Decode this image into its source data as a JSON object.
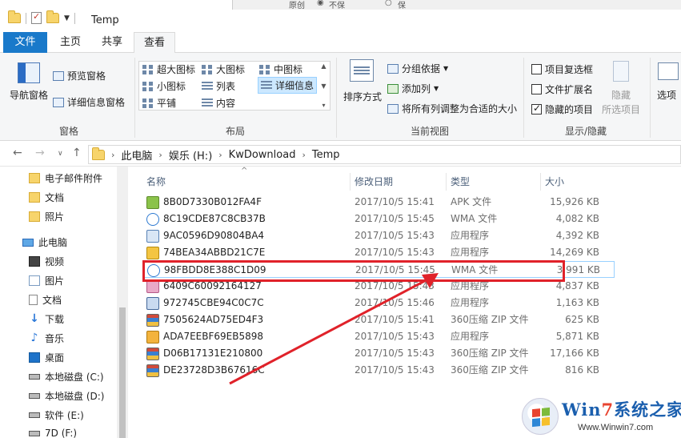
{
  "window": {
    "title": "Temp"
  },
  "top_strip": {
    "label_a": "原创",
    "option_a": "不保",
    "option_b": "保"
  },
  "tabs": {
    "file": "文件",
    "home": "主页",
    "share": "共享",
    "view": "查看"
  },
  "ribbon": {
    "panes": {
      "nav_pane": "导航窗格",
      "preview_pane": "预览窗格",
      "details_pane": "详细信息窗格",
      "group": "窗格"
    },
    "layout": {
      "group": "布局",
      "xl_icons": "超大图标",
      "large_icons": "大图标",
      "medium_icons": "中图标",
      "small_icons": "小图标",
      "list": "列表",
      "details": "详细信息",
      "tiles": "平铺",
      "content": "内容"
    },
    "current_view": {
      "group": "当前视图",
      "sort_by": "排序方式",
      "group_by": "分组依据",
      "add_column": "添加列",
      "fit_columns": "将所有列调整为合适的大小"
    },
    "show_hide": {
      "group": "显示/隐藏",
      "item_checkboxes": "项目复选框",
      "file_ext": "文件扩展名",
      "hidden_items": "隐藏的项目",
      "hide": "隐藏",
      "selected_items": "所选项目"
    },
    "options": "选项"
  },
  "address": {
    "crumbs": [
      "此电脑",
      "娱乐 (H:)",
      "KwDownload",
      "Temp"
    ]
  },
  "navpane": {
    "items": [
      "电子邮件附件",
      "文档",
      "照片",
      "此电脑",
      "视频",
      "图片",
      "文档",
      "下载",
      "音乐",
      "桌面",
      "本地磁盘 (C:)",
      "本地磁盘 (D:)",
      "软件 (E:)",
      "7D (F:)"
    ]
  },
  "columns": {
    "name": "名称",
    "date": "修改日期",
    "type": "类型",
    "size": "大小"
  },
  "files": [
    {
      "name": "8B0D7330B012FA4F",
      "date": "2017/10/5 15:41",
      "type": "APK 文件",
      "size": "15,926 KB"
    },
    {
      "name": "8C19CDE87C8CB37B",
      "date": "2017/10/5 15:45",
      "type": "WMA 文件",
      "size": "4,082 KB"
    },
    {
      "name": "9AC0596D90804BA4",
      "date": "2017/10/5 15:43",
      "type": "应用程序",
      "size": "4,392 KB"
    },
    {
      "name": "74BEA34ABBD21C7E",
      "date": "2017/10/5 15:43",
      "type": "应用程序",
      "size": "14,269 KB"
    },
    {
      "name": "98FBDD8E388C1D09",
      "date": "2017/10/5 15:45",
      "type": "WMA 文件",
      "size": "3,991 KB"
    },
    {
      "name": "6409C60092164127",
      "date": "2017/10/5 15:43",
      "type": "应用程序",
      "size": "4,837 KB"
    },
    {
      "name": "972745CBE94C0C7C",
      "date": "2017/10/5 15:46",
      "type": "应用程序",
      "size": "1,163 KB"
    },
    {
      "name": "7505624AD75ED4F3",
      "date": "2017/10/5 15:41",
      "type": "360压缩 ZIP 文件",
      "size": "625 KB"
    },
    {
      "name": "ADA7EEBF69EB5898",
      "date": "2017/10/5 15:43",
      "type": "应用程序",
      "size": "5,871 KB"
    },
    {
      "name": "D06B17131E210800",
      "date": "2017/10/5 15:43",
      "type": "360压缩 ZIP 文件",
      "size": "17,166 KB"
    },
    {
      "name": "DE23728D3B67616C",
      "date": "2017/10/5 15:43",
      "type": "360压缩 ZIP 文件",
      "size": "816 KB"
    }
  ],
  "watermark": {
    "brand_a": "Win",
    "brand_num": "7",
    "brand_b": "系统之家",
    "url": "Www.Winwin7.com"
  },
  "colors": {
    "accent": "#1979ca",
    "annotation": "#e0222a",
    "selection": "#cce8ff"
  }
}
